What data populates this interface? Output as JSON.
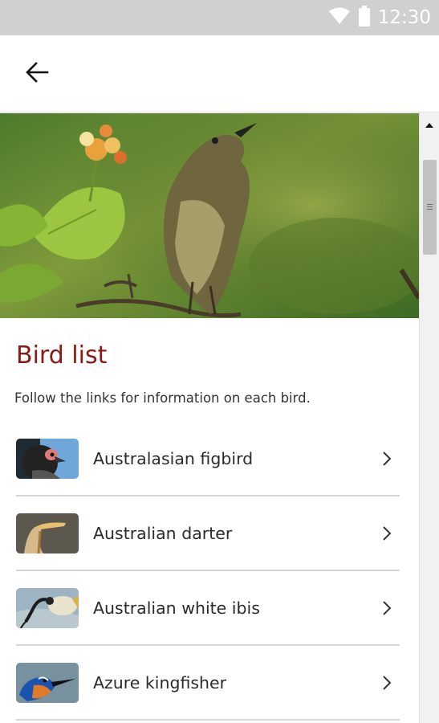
{
  "status_bar": {
    "time": "12:30",
    "icons": [
      "wifi-icon",
      "battery-icon"
    ],
    "background": "#d0d0d0"
  },
  "app_bar": {
    "back_icon": "arrow-left-icon"
  },
  "page": {
    "title": "Bird list",
    "title_color": "#8b1a16",
    "intro": "Follow the links for information on each bird."
  },
  "birds": [
    {
      "name": "Australasian figbird",
      "thumbnail": "figbird-thumbnail"
    },
    {
      "name": "Australian darter",
      "thumbnail": "darter-thumbnail"
    },
    {
      "name": "Australian white ibis",
      "thumbnail": "ibis-thumbnail"
    },
    {
      "name": "Azure kingfisher",
      "thumbnail": "kingfisher-thumbnail"
    }
  ]
}
